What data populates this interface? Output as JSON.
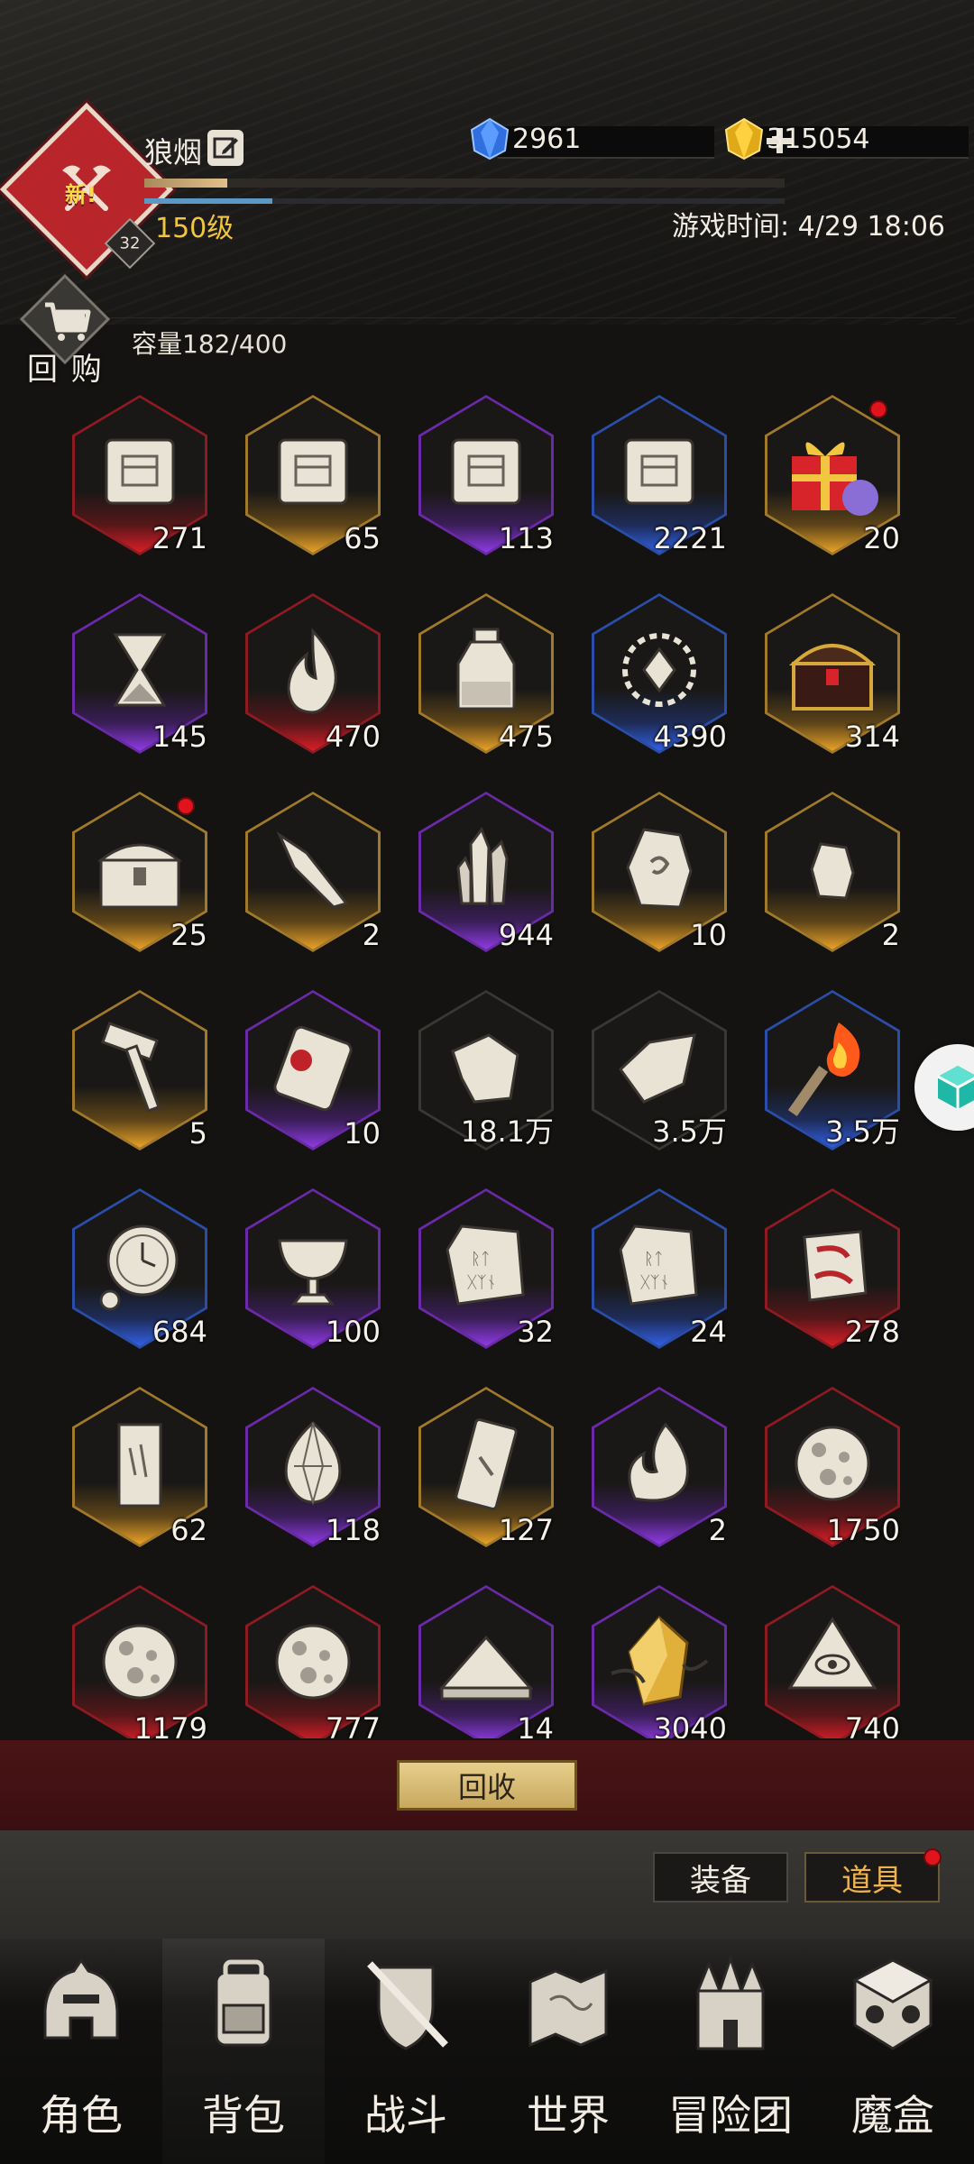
{
  "header": {
    "player_name": "狼烟",
    "new_tag": "新!",
    "badge_number": "32",
    "level": "150级",
    "game_time": "游戏时间: 4/29 18:06",
    "xp_fraction": 0.13,
    "mp_fraction": 0.2
  },
  "resources": {
    "gems": "2961",
    "gold": "315054"
  },
  "bag": {
    "buyback_label": "回 购",
    "capacity": "容量182/400",
    "recycle_label": "回收"
  },
  "items": [
    {
      "name": "map-scroll-icon",
      "rarity": "red",
      "count": "271"
    },
    {
      "name": "map-scroll-icon",
      "rarity": "gold",
      "count": "65"
    },
    {
      "name": "map-scroll-icon",
      "rarity": "purple",
      "count": "113"
    },
    {
      "name": "map-scroll-icon",
      "rarity": "blue",
      "count": "2221"
    },
    {
      "name": "gift-box-icon",
      "rarity": "gold",
      "count": "20",
      "dot": true
    },
    {
      "name": "hourglass-icon",
      "rarity": "purple",
      "count": "145"
    },
    {
      "name": "flame-icon",
      "rarity": "red",
      "count": "470"
    },
    {
      "name": "sand-jar-icon",
      "rarity": "gold",
      "count": "475"
    },
    {
      "name": "laurel-crystal-icon",
      "rarity": "blue",
      "count": "4390"
    },
    {
      "name": "treasure-chest-icon",
      "rarity": "gold",
      "count": "314"
    },
    {
      "name": "chest-icon",
      "rarity": "gold",
      "count": "25",
      "dot": true
    },
    {
      "name": "crystal-shard-icon",
      "rarity": "gold",
      "count": "2"
    },
    {
      "name": "crystal-cluster-icon",
      "rarity": "purple",
      "count": "944"
    },
    {
      "name": "rune-stone-icon",
      "rarity": "gold",
      "count": "10"
    },
    {
      "name": "small-rune-icon",
      "rarity": "gold",
      "count": "2"
    },
    {
      "name": "hammer-icon",
      "rarity": "gold",
      "count": "5"
    },
    {
      "name": "sealed-scroll-icon",
      "rarity": "purple",
      "count": "10"
    },
    {
      "name": "fragment-icon",
      "rarity": "gray",
      "count": "18.1万"
    },
    {
      "name": "torn-scroll-icon",
      "rarity": "gray",
      "count": "3.5万"
    },
    {
      "name": "torch-icon",
      "rarity": "blue",
      "count": "3.5万"
    },
    {
      "name": "pocket-watch-icon",
      "rarity": "blue",
      "count": "684"
    },
    {
      "name": "chalice-icon",
      "rarity": "purple",
      "count": "100"
    },
    {
      "name": "rune-tablet-icon",
      "rarity": "purple",
      "count": "32"
    },
    {
      "name": "rune-tablet-icon",
      "rarity": "blue",
      "count": "24"
    },
    {
      "name": "marked-stone-icon",
      "rarity": "red",
      "count": "278"
    },
    {
      "name": "tombstone-icon",
      "rarity": "gold",
      "count": "62"
    },
    {
      "name": "gem-icon",
      "rarity": "purple",
      "count": "118"
    },
    {
      "name": "stone-slab-icon",
      "rarity": "gold",
      "count": "127"
    },
    {
      "name": "spirit-flame-icon",
      "rarity": "purple",
      "count": "2"
    },
    {
      "name": "meteorite-icon",
      "rarity": "red",
      "count": "1750"
    },
    {
      "name": "meteorite-icon",
      "rarity": "red",
      "count": "1179"
    },
    {
      "name": "meteorite-icon",
      "rarity": "red",
      "count": "777"
    },
    {
      "name": "sand-pile-icon",
      "rarity": "purple",
      "count": "14"
    },
    {
      "name": "golden-crystal-icon",
      "rarity": "purple",
      "count": "3040"
    },
    {
      "name": "eye-pyramid-icon",
      "rarity": "red",
      "count": "740"
    }
  ],
  "subtabs": {
    "equipment": "装备",
    "items": "道具"
  },
  "nav": [
    {
      "label": "角色",
      "icon": "helmet-icon"
    },
    {
      "label": "背包",
      "icon": "backpack-icon"
    },
    {
      "label": "战斗",
      "icon": "sword-shield-icon"
    },
    {
      "label": "世界",
      "icon": "world-map-icon"
    },
    {
      "label": "冒险团",
      "icon": "castle-icon"
    },
    {
      "label": "魔盒",
      "icon": "magic-cube-icon"
    }
  ],
  "colors": {
    "red": "#8e1a22",
    "gold": "#a07a2a",
    "purple": "#6a2aa8",
    "blue": "#2a4ea8",
    "level_text": "#f0c540",
    "active_subtab": "#f0b24a"
  }
}
